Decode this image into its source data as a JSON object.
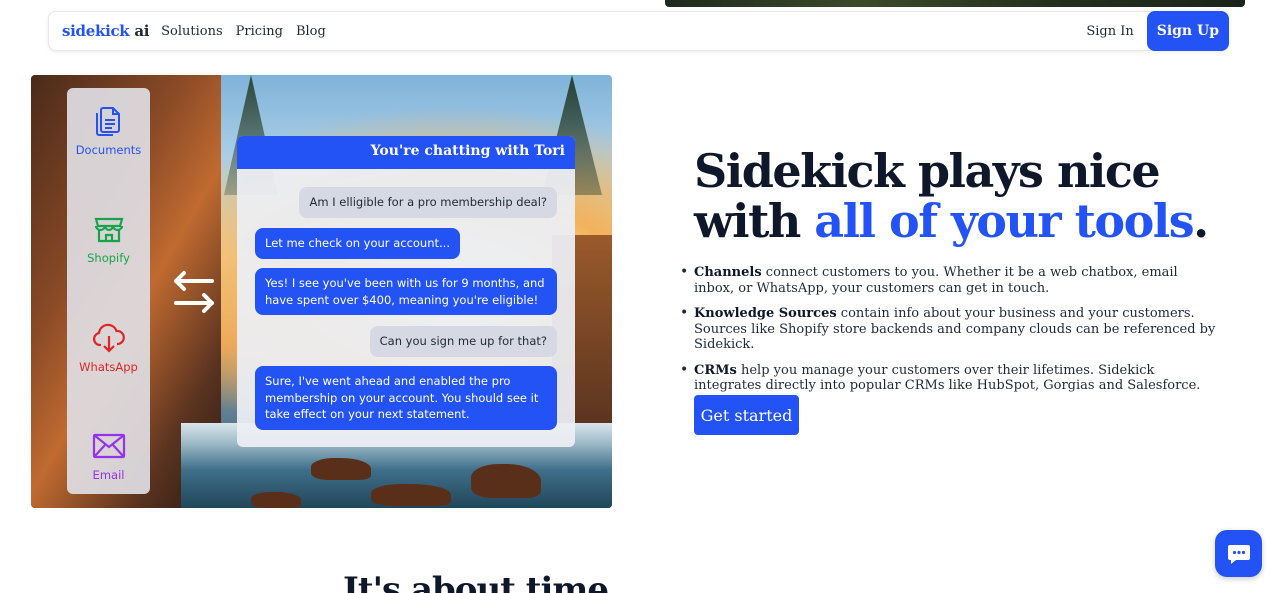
{
  "nav": {
    "logo_main": "sidekick",
    "logo_suffix": " ai",
    "links": [
      "Solutions",
      "Pricing",
      "Blog"
    ],
    "signin": "Sign In",
    "signup": "Sign Up"
  },
  "rail": {
    "items": [
      {
        "label": "Documents",
        "icon": "documents-icon"
      },
      {
        "label": "Shopify",
        "icon": "shop-icon"
      },
      {
        "label": "WhatsApp",
        "icon": "cloud-download-icon"
      },
      {
        "label": "Email",
        "icon": "envelope-icon"
      }
    ]
  },
  "chat": {
    "header_prefix": "You're chatting with ",
    "agent_name": "Tori",
    "messages": [
      {
        "from": "user",
        "text": "Am I elligible for a pro membership deal?"
      },
      {
        "from": "bot",
        "text": "Let me check on your account..."
      },
      {
        "from": "bot",
        "text": "Yes! I see you've been with us for 9 months, and have spent over $400, meaning you're eligible!"
      },
      {
        "from": "user",
        "text": "Can you sign me up for that?"
      },
      {
        "from": "bot",
        "text": "Sure, I've went ahead and enabled the pro membership on your account. You should see it take effect on your next statement."
      }
    ]
  },
  "hero": {
    "headline_line1": "Sidekick plays nice",
    "headline_with": "with ",
    "headline_accent": "all of your tools",
    "headline_period": ".",
    "features": [
      {
        "term": "Channels",
        "text": " connect customers to you. Whether it be a web chatbox, email inbox, or WhatsApp, your customers can get in touch."
      },
      {
        "term": "Knowledge Sources",
        "text": " contain info about your business and your customers. Sources like Shopify store backends and company clouds can be referenced by Sidekick."
      },
      {
        "term": "CRMs",
        "text": " help you manage your customers over their lifetimes. Sidekick integrates directly into popular CRMs like HubSpot, Gorgias and Salesforce."
      }
    ],
    "cta": "Get started"
  },
  "next_section": {
    "heading": "It's about time"
  },
  "colors": {
    "accent": "#2352f5",
    "dark": "#0f172a"
  }
}
